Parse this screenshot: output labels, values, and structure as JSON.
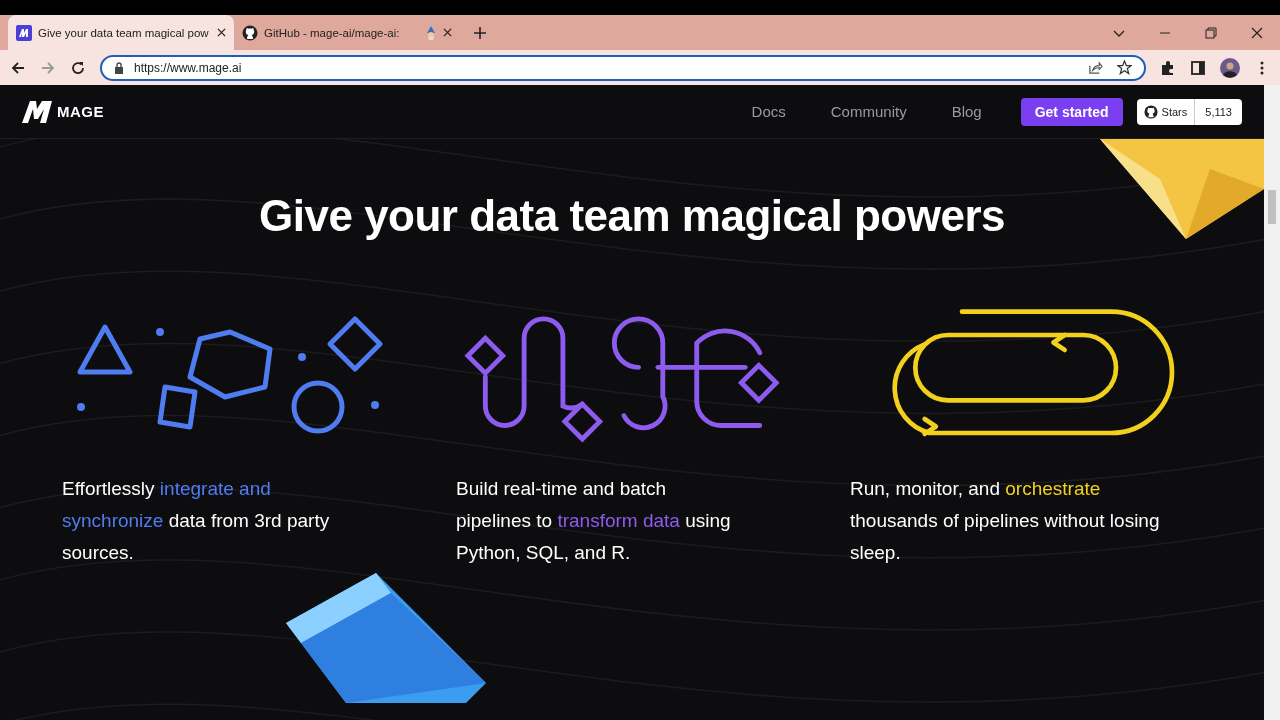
{
  "browser": {
    "tabs": [
      {
        "title": "Give your data team magical pow",
        "selected": true,
        "kind": "site"
      },
      {
        "title": "GitHub - mage-ai/mage-ai:",
        "selected": false,
        "kind": "repo"
      }
    ],
    "url": "https://www.mage.ai"
  },
  "nav": {
    "logo": "MAGE",
    "links": [
      "Docs",
      "Community",
      "Blog"
    ],
    "cta": "Get started",
    "stars_label": "Stars",
    "stars_count": "5,113"
  },
  "hero": {
    "title": "Give your data team magical powers"
  },
  "features": [
    {
      "kind": "shapes",
      "color": "#4f7cf0",
      "parts": [
        {
          "text": "Effortlessly ",
          "highlight": false
        },
        {
          "text": "integrate and synchronize",
          "highlight": true
        },
        {
          "text": " data from 3rd party sources.",
          "highlight": false
        }
      ]
    },
    {
      "kind": "pipes",
      "color": "#8e5bef",
      "parts": [
        {
          "text": "Build real-time and batch pipelines to ",
          "highlight": false
        },
        {
          "text": "transform data",
          "highlight": true
        },
        {
          "text": " using Python, SQL, and R.",
          "highlight": false
        }
      ]
    },
    {
      "kind": "loop",
      "color": "#f2d11e",
      "parts": [
        {
          "text": "Run, monitor, and ",
          "highlight": false
        },
        {
          "text": "orchestrate",
          "highlight": true
        },
        {
          "text": " thousands of pipelines without losing sleep.",
          "highlight": false
        }
      ]
    }
  ]
}
